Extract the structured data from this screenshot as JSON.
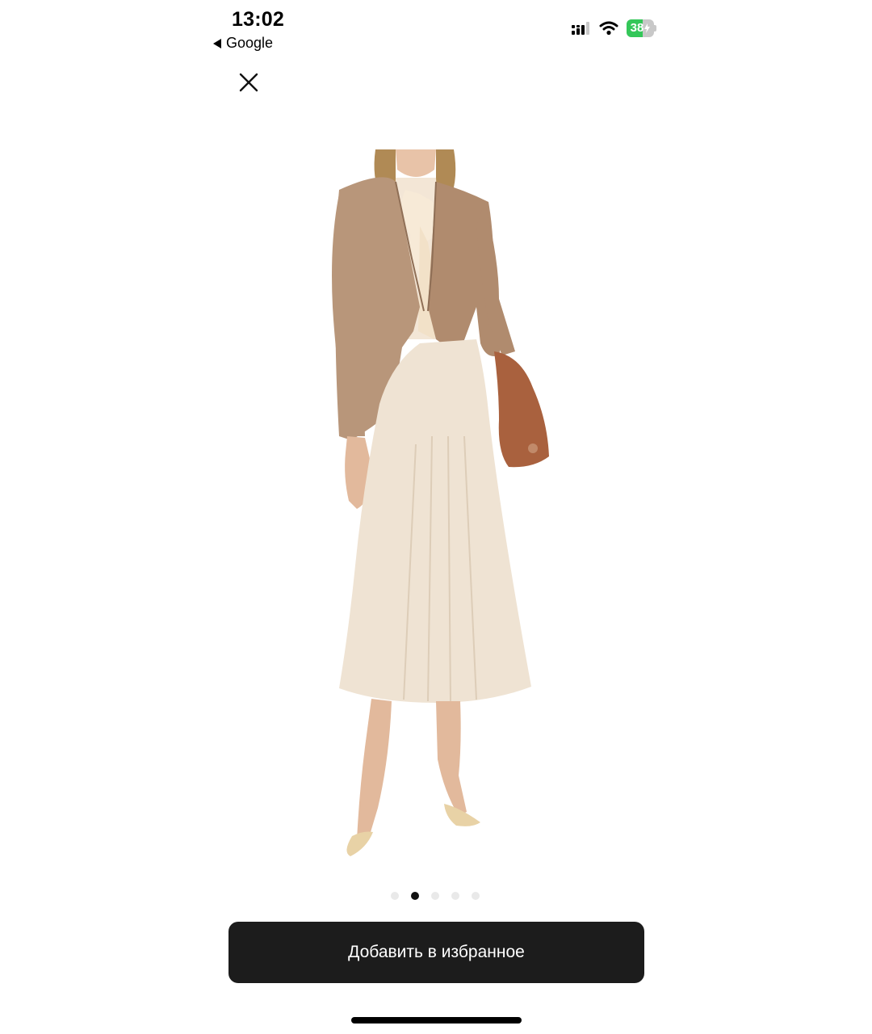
{
  "status_bar": {
    "time": "13:02",
    "back_label": "Google",
    "battery_level": "38",
    "icons": [
      "cellular-signal-icon",
      "wifi-icon",
      "battery-charging-icon"
    ]
  },
  "close": {
    "icon": "close-icon"
  },
  "gallery": {
    "pages": 5,
    "active_page": 2
  },
  "cta": {
    "favorite_label": "Добавить в избранное"
  },
  "colors": {
    "cta_background": "#1c1c1c",
    "battery_green": "#34c759",
    "dot_active": "#111111",
    "dot_inactive": "#e9e9e9",
    "blazer": "#b8967a",
    "skirt": "#efe3d3",
    "bag": "#a9613e"
  }
}
